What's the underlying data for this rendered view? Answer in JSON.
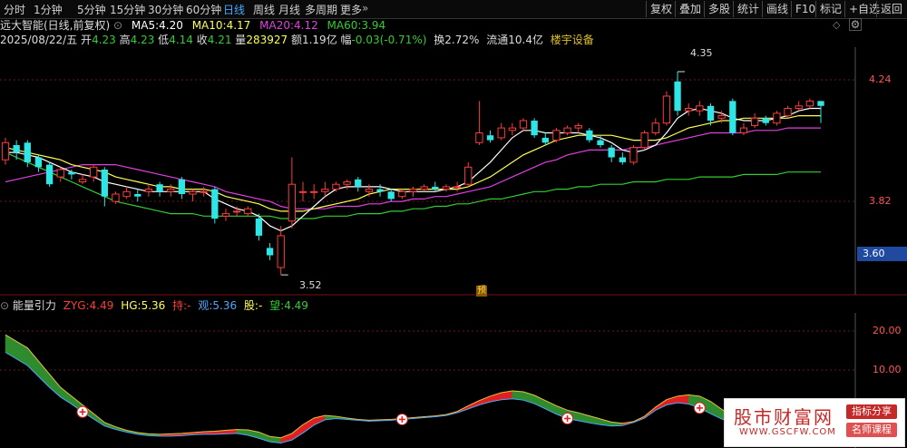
{
  "toolbar": {
    "timeframes": [
      "分时",
      "1分钟",
      "5分钟",
      "15分钟",
      "30分钟",
      "60分钟",
      "日线",
      "周线",
      "月线",
      "多周期",
      "更多"
    ],
    "active": "日线",
    "more_arrow": "»",
    "right_buttons": [
      "复权",
      "叠加",
      "多股",
      "统计",
      "画线",
      "F10",
      "标记",
      "+自选",
      "返回"
    ]
  },
  "stock": {
    "name": "远大智能(日线,前复权)",
    "ma5_label": "MA5:",
    "ma5": "4.20",
    "ma10_label": "MA10:",
    "ma10": "4.17",
    "ma20_label": "MA20:",
    "ma20": "4.12",
    "ma60_label": "MA60:",
    "ma60": "3.94",
    "date": "2025/08/22/五",
    "open_label": "开",
    "open": "4.23",
    "high_label": "高",
    "high": "4.23",
    "low_label": "低",
    "low": "4.14",
    "close_label": "收",
    "close": "4.21",
    "vol_label": "量",
    "vol": "283927",
    "amount_label": "额",
    "amount": "1.19亿",
    "change_label": "幅",
    "change": "-0.03(-0.71%)",
    "turnover_label": "换",
    "turnover": "2.72%",
    "float_label": "流通",
    "float": "10.4亿",
    "sector": "楼宇设备"
  },
  "price_axis": {
    "ticks": [
      "4.24",
      "3.82"
    ],
    "current_label": "3.60"
  },
  "annotations": {
    "high_mark": "4.35",
    "low_mark": "3.52",
    "forecast_badge": "预"
  },
  "indicator": {
    "name": "能量引力",
    "zyg_label": "ZYG:",
    "zyg": "4.49",
    "hg_label": "HG:",
    "hg": "5.36",
    "chi_label": "持:",
    "chi": "-",
    "guan_label": "观:",
    "guan": "5.36",
    "gu_label": "股:",
    "gu": "-",
    "wang_label": "望:",
    "wang": "4.49",
    "ticks": [
      "20.00",
      "10.00"
    ]
  },
  "watermark": {
    "title": "股市财富网",
    "url": "WWW.GSCFW.COM",
    "tag1": "指标分享",
    "tag2": "名师课程"
  },
  "colors": {
    "up": "#ff3b3b",
    "down": "#2ee6e6",
    "ma5": "#ffffff",
    "ma10": "#ffff55",
    "ma20": "#e040e0",
    "ma60": "#33cc33",
    "active_tab": "#4aa8ff",
    "current_price_box": "#1f4aa0"
  },
  "chart_data": {
    "type": "candlestick",
    "ylim": [
      3.45,
      4.45
    ],
    "candles": [
      {
        "o": 3.99,
        "c": 4.06,
        "h": 4.08,
        "l": 3.97
      },
      {
        "o": 4.05,
        "c": 4.02,
        "h": 4.07,
        "l": 3.99
      },
      {
        "o": 4.06,
        "c": 3.98,
        "h": 4.07,
        "l": 3.96
      },
      {
        "o": 4.0,
        "c": 3.96,
        "h": 4.01,
        "l": 3.94
      },
      {
        "o": 3.97,
        "c": 3.89,
        "h": 3.98,
        "l": 3.88
      },
      {
        "o": 3.92,
        "c": 3.95,
        "h": 3.96,
        "l": 3.9
      },
      {
        "o": 3.94,
        "c": 3.93,
        "h": 3.95,
        "l": 3.91
      },
      {
        "o": 3.9,
        "c": 3.91,
        "h": 3.93,
        "l": 3.89
      },
      {
        "o": 3.92,
        "c": 3.96,
        "h": 3.97,
        "l": 3.9
      },
      {
        "o": 3.95,
        "c": 3.84,
        "h": 3.96,
        "l": 3.8
      },
      {
        "o": 3.82,
        "c": 3.85,
        "h": 3.86,
        "l": 3.81
      },
      {
        "o": 3.84,
        "c": 3.86,
        "h": 3.88,
        "l": 3.83
      },
      {
        "o": 3.85,
        "c": 3.84,
        "h": 3.87,
        "l": 3.82
      },
      {
        "o": 3.86,
        "c": 3.87,
        "h": 3.89,
        "l": 3.84
      },
      {
        "o": 3.89,
        "c": 3.86,
        "h": 3.9,
        "l": 3.84
      },
      {
        "o": 3.86,
        "c": 3.87,
        "h": 3.89,
        "l": 3.84
      },
      {
        "o": 3.91,
        "c": 3.85,
        "h": 3.92,
        "l": 3.83
      },
      {
        "o": 3.85,
        "c": 3.86,
        "h": 3.87,
        "l": 3.82
      },
      {
        "o": 3.86,
        "c": 3.86,
        "h": 3.88,
        "l": 3.84
      },
      {
        "o": 3.87,
        "c": 3.75,
        "h": 3.88,
        "l": 3.73
      },
      {
        "o": 3.76,
        "c": 3.77,
        "h": 3.79,
        "l": 3.74
      },
      {
        "o": 3.78,
        "c": 3.78,
        "h": 3.8,
        "l": 3.76
      },
      {
        "o": 3.77,
        "c": 3.79,
        "h": 3.8,
        "l": 3.76
      },
      {
        "o": 3.75,
        "c": 3.68,
        "h": 3.77,
        "l": 3.66
      },
      {
        "o": 3.63,
        "c": 3.6,
        "h": 3.65,
        "l": 3.58
      },
      {
        "o": 3.55,
        "c": 3.68,
        "h": 3.72,
        "l": 3.52
      },
      {
        "o": 3.74,
        "c": 3.89,
        "h": 4.0,
        "l": 3.71
      },
      {
        "o": 3.86,
        "c": 3.86,
        "h": 3.9,
        "l": 3.82
      },
      {
        "o": 3.86,
        "c": 3.86,
        "h": 3.89,
        "l": 3.83
      },
      {
        "o": 3.86,
        "c": 3.87,
        "h": 3.9,
        "l": 3.84
      },
      {
        "o": 3.87,
        "c": 3.89,
        "h": 3.9,
        "l": 3.86
      },
      {
        "o": 3.89,
        "c": 3.9,
        "h": 3.91,
        "l": 3.87
      },
      {
        "o": 3.91,
        "c": 3.88,
        "h": 3.92,
        "l": 3.86
      },
      {
        "o": 3.86,
        "c": 3.87,
        "h": 3.89,
        "l": 3.84
      },
      {
        "o": 3.87,
        "c": 3.86,
        "h": 3.89,
        "l": 3.84
      },
      {
        "o": 3.86,
        "c": 3.83,
        "h": 3.87,
        "l": 3.82
      },
      {
        "o": 3.84,
        "c": 3.86,
        "h": 3.87,
        "l": 3.83
      },
      {
        "o": 3.86,
        "c": 3.87,
        "h": 3.88,
        "l": 3.84
      },
      {
        "o": 3.87,
        "c": 3.88,
        "h": 3.89,
        "l": 3.86
      },
      {
        "o": 3.88,
        "c": 3.87,
        "h": 3.9,
        "l": 3.86
      },
      {
        "o": 3.87,
        "c": 3.88,
        "h": 3.89,
        "l": 3.86
      },
      {
        "o": 3.88,
        "c": 3.88,
        "h": 3.9,
        "l": 3.86
      },
      {
        "o": 3.89,
        "c": 3.96,
        "h": 3.98,
        "l": 3.88
      },
      {
        "o": 4.06,
        "c": 4.1,
        "h": 4.23,
        "l": 4.05
      },
      {
        "o": 4.09,
        "c": 4.07,
        "h": 4.11,
        "l": 4.06
      },
      {
        "o": 4.08,
        "c": 4.12,
        "h": 4.14,
        "l": 4.07
      },
      {
        "o": 4.11,
        "c": 4.12,
        "h": 4.14,
        "l": 4.09
      },
      {
        "o": 4.12,
        "c": 4.15,
        "h": 4.16,
        "l": 4.11
      },
      {
        "o": 4.15,
        "c": 4.09,
        "h": 4.16,
        "l": 4.08
      },
      {
        "o": 4.08,
        "c": 4.06,
        "h": 4.1,
        "l": 4.05
      },
      {
        "o": 4.07,
        "c": 4.11,
        "h": 4.12,
        "l": 4.06
      },
      {
        "o": 4.1,
        "c": 4.12,
        "h": 4.13,
        "l": 4.09
      },
      {
        "o": 4.12,
        "c": 4.13,
        "h": 4.14,
        "l": 4.1
      },
      {
        "o": 4.11,
        "c": 4.07,
        "h": 4.12,
        "l": 4.06
      },
      {
        "o": 4.07,
        "c": 4.05,
        "h": 4.09,
        "l": 4.04
      },
      {
        "o": 4.04,
        "c": 4.0,
        "h": 4.05,
        "l": 3.98
      },
      {
        "o": 4.0,
        "c": 3.98,
        "h": 4.02,
        "l": 3.97
      },
      {
        "o": 3.98,
        "c": 4.04,
        "h": 4.05,
        "l": 3.97
      },
      {
        "o": 4.04,
        "c": 4.1,
        "h": 4.11,
        "l": 4.03
      },
      {
        "o": 4.1,
        "c": 4.14,
        "h": 4.16,
        "l": 4.09
      },
      {
        "o": 4.14,
        "c": 4.25,
        "h": 4.27,
        "l": 4.13
      },
      {
        "o": 4.31,
        "c": 4.19,
        "h": 4.35,
        "l": 4.17
      },
      {
        "o": 4.19,
        "c": 4.2,
        "h": 4.22,
        "l": 4.17
      },
      {
        "o": 4.19,
        "c": 4.21,
        "h": 4.23,
        "l": 4.17
      },
      {
        "o": 4.21,
        "c": 4.15,
        "h": 4.22,
        "l": 4.13
      },
      {
        "o": 4.16,
        "c": 4.17,
        "h": 4.19,
        "l": 4.14
      },
      {
        "o": 4.23,
        "c": 4.1,
        "h": 4.24,
        "l": 4.09
      },
      {
        "o": 4.1,
        "c": 4.12,
        "h": 4.14,
        "l": 4.09
      },
      {
        "o": 4.13,
        "c": 4.16,
        "h": 4.18,
        "l": 4.12
      },
      {
        "o": 4.16,
        "c": 4.14,
        "h": 4.17,
        "l": 4.13
      },
      {
        "o": 4.14,
        "c": 4.18,
        "h": 4.19,
        "l": 4.13
      },
      {
        "o": 4.17,
        "c": 4.2,
        "h": 4.21,
        "l": 4.16
      },
      {
        "o": 4.2,
        "c": 4.21,
        "h": 4.23,
        "l": 4.19
      },
      {
        "o": 4.21,
        "c": 4.23,
        "h": 4.24,
        "l": 4.2
      },
      {
        "o": 4.23,
        "c": 4.21,
        "h": 4.23,
        "l": 4.14
      }
    ],
    "ma5": [
      4.02,
      4.02,
      4.01,
      4.0,
      3.98,
      3.96,
      3.94,
      3.93,
      3.92,
      3.9,
      3.89,
      3.88,
      3.87,
      3.86,
      3.86,
      3.86,
      3.86,
      3.86,
      3.86,
      3.83,
      3.81,
      3.79,
      3.78,
      3.76,
      3.72,
      3.7,
      3.72,
      3.76,
      3.8,
      3.84,
      3.87,
      3.88,
      3.88,
      3.88,
      3.88,
      3.87,
      3.86,
      3.86,
      3.86,
      3.86,
      3.87,
      3.88,
      3.9,
      3.94,
      3.98,
      4.03,
      4.08,
      4.11,
      4.11,
      4.1,
      4.1,
      4.1,
      4.1,
      4.09,
      4.08,
      4.06,
      4.03,
      4.02,
      4.03,
      4.05,
      4.1,
      4.16,
      4.19,
      4.2,
      4.19,
      4.18,
      4.16,
      4.15,
      4.15,
      4.15,
      4.16,
      4.17,
      4.19,
      4.2,
      4.2
    ],
    "ma10": [
      4.04,
      4.03,
      4.02,
      4.01,
      4.0,
      3.99,
      3.97,
      3.96,
      3.95,
      3.94,
      3.92,
      3.91,
      3.9,
      3.89,
      3.88,
      3.88,
      3.87,
      3.87,
      3.87,
      3.86,
      3.84,
      3.83,
      3.82,
      3.81,
      3.79,
      3.78,
      3.78,
      3.78,
      3.79,
      3.8,
      3.81,
      3.82,
      3.83,
      3.85,
      3.86,
      3.87,
      3.87,
      3.87,
      3.87,
      3.87,
      3.87,
      3.87,
      3.88,
      3.9,
      3.92,
      3.95,
      3.98,
      4.01,
      4.03,
      4.05,
      4.07,
      4.08,
      4.09,
      4.09,
      4.09,
      4.09,
      4.08,
      4.07,
      4.07,
      4.07,
      4.08,
      4.1,
      4.12,
      4.13,
      4.14,
      4.15,
      4.15,
      4.16,
      4.16,
      4.16,
      4.16,
      4.16,
      4.17,
      4.17,
      4.17
    ],
    "ma20": [
      3.9,
      3.91,
      3.92,
      3.93,
      3.94,
      3.95,
      3.96,
      3.97,
      3.97,
      3.97,
      3.97,
      3.96,
      3.95,
      3.94,
      3.93,
      3.92,
      3.91,
      3.9,
      3.89,
      3.88,
      3.86,
      3.85,
      3.84,
      3.83,
      3.82,
      3.8,
      3.79,
      3.79,
      3.79,
      3.79,
      3.8,
      3.8,
      3.8,
      3.81,
      3.81,
      3.82,
      3.82,
      3.83,
      3.83,
      3.84,
      3.84,
      3.85,
      3.86,
      3.87,
      3.88,
      3.9,
      3.92,
      3.94,
      3.96,
      3.98,
      3.99,
      4.01,
      4.02,
      4.03,
      4.03,
      4.03,
      4.03,
      4.04,
      4.04,
      4.05,
      4.06,
      4.07,
      4.08,
      4.09,
      4.1,
      4.1,
      4.1,
      4.1,
      4.11,
      4.11,
      4.11,
      4.12,
      4.12,
      4.12,
      4.12
    ],
    "ma60": [
      4.02,
      4.0,
      3.98,
      3.96,
      3.94,
      3.92,
      3.9,
      3.88,
      3.86,
      3.84,
      3.82,
      3.81,
      3.8,
      3.79,
      3.78,
      3.77,
      3.77,
      3.77,
      3.76,
      3.76,
      3.76,
      3.76,
      3.76,
      3.76,
      3.76,
      3.75,
      3.75,
      3.75,
      3.75,
      3.76,
      3.76,
      3.76,
      3.77,
      3.77,
      3.77,
      3.78,
      3.78,
      3.79,
      3.79,
      3.8,
      3.8,
      3.81,
      3.81,
      3.82,
      3.83,
      3.83,
      3.84,
      3.85,
      3.86,
      3.86,
      3.87,
      3.87,
      3.88,
      3.88,
      3.89,
      3.89,
      3.89,
      3.9,
      3.9,
      3.9,
      3.91,
      3.91,
      3.91,
      3.92,
      3.92,
      3.92,
      3.92,
      3.93,
      3.93,
      3.93,
      3.93,
      3.94,
      3.94,
      3.94,
      3.94
    ],
    "indicator": {
      "ylim": [
        0,
        30
      ],
      "upper": [
        25.0,
        23.5,
        22.0,
        19.0,
        16.0,
        13.0,
        11.0,
        9.0,
        7.0,
        5.0,
        4.0,
        3.2,
        2.7,
        2.4,
        2.3,
        2.4,
        2.5,
        2.7,
        2.9,
        3.0,
        3.2,
        3.4,
        3.3,
        2.8,
        1.8,
        1.5,
        2.5,
        4.5,
        6.0,
        6.6,
        6.4,
        6.0,
        5.7,
        5.5,
        5.6,
        5.7,
        5.9,
        6.1,
        6.3,
        6.5,
        6.8,
        7.5,
        8.8,
        10.0,
        11.0,
        11.8,
        12.2,
        12.0,
        11.2,
        10.0,
        8.8,
        7.8,
        7.2,
        6.5,
        5.8,
        5.1,
        4.8,
        5.2,
        6.4,
        8.5,
        10.2,
        11.0,
        11.3,
        11.0,
        9.8,
        8.0,
        6.5,
        5.2,
        4.6,
        4.4,
        4.7,
        5.3,
        6.0,
        6.1,
        5.9
      ],
      "lower": [
        21.0,
        19.5,
        18.0,
        15.5,
        13.0,
        10.8,
        9.2,
        7.4,
        5.8,
        4.2,
        3.4,
        2.8,
        2.3,
        2.0,
        1.9,
        1.9,
        2.0,
        2.2,
        2.3,
        2.3,
        2.4,
        2.5,
        2.1,
        1.4,
        0.6,
        0.3,
        1.0,
        2.6,
        4.4,
        5.6,
        5.9,
        5.7,
        5.5,
        5.3,
        5.4,
        5.5,
        5.7,
        5.9,
        6.1,
        6.3,
        6.6,
        7.2,
        8.1,
        9.0,
        9.7,
        10.2,
        10.4,
        10.1,
        9.3,
        8.1,
        6.9,
        5.9,
        5.4,
        4.9,
        4.5,
        4.2,
        4.3,
        5.0,
        6.0,
        7.8,
        9.0,
        9.5,
        9.2,
        8.3,
        7.0,
        5.8,
        4.8,
        4.2,
        3.8,
        3.8,
        4.2,
        4.8,
        5.4,
        5.7,
        5.5
      ],
      "signals": [
        7,
        36,
        51,
        63
      ]
    }
  }
}
